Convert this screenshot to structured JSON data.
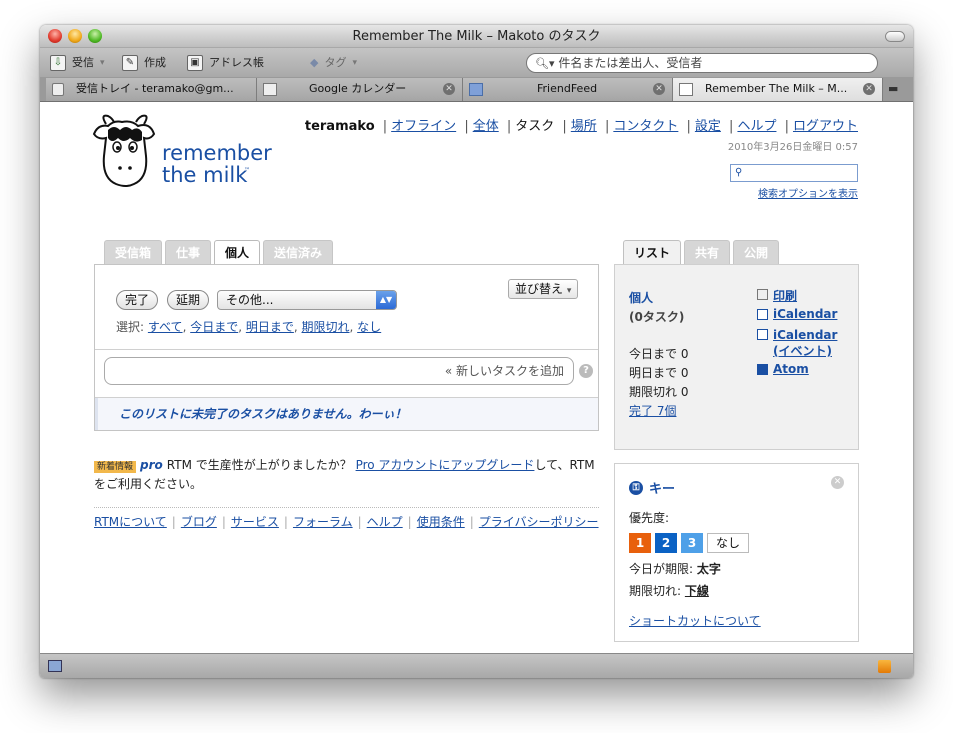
{
  "window": {
    "title": "Remember The Milk – Makoto のタスク"
  },
  "toolbar": {
    "receive_label": "受信",
    "compose_label": "作成",
    "addressbook_label": "アドレス帳",
    "tag_label": "タグ",
    "search_placeholder": "件名または差出人、受信者"
  },
  "tabs": [
    {
      "label": "受信トレイ - teramako@gm..."
    },
    {
      "label": "Google カレンダー"
    },
    {
      "label": "FriendFeed"
    },
    {
      "label": "Remember The Milk – M..."
    }
  ],
  "topnav": {
    "user": "teramako",
    "links": [
      "オフライン",
      "全体",
      "タスク",
      "場所",
      "コンタクト",
      "設定",
      "ヘルプ",
      "ログアウト"
    ],
    "current": "タスク",
    "date": "2010年3月26日金曜日 0:57",
    "search_options": "検索オプションを表示"
  },
  "logo": {
    "line1": "remember",
    "line2": "the milk",
    "tm": "™"
  },
  "main_tabs": [
    "受信箱",
    "仕事",
    "個人",
    "送信済み"
  ],
  "active_main_tab": "個人",
  "actions": {
    "complete": "完了",
    "postpone": "延期",
    "more": "その他...",
    "sort": "並び替え"
  },
  "select_row": {
    "label": "選択:",
    "options": [
      "すべて",
      "今日まで",
      "明日まで",
      "期限切れ",
      "なし"
    ]
  },
  "add_task_placeholder": "« 新しいタスクを追加",
  "empty_message": "このリストに未完了のタスクはありません。わーぃ！",
  "promo": {
    "badge": "新着情報",
    "pro": "pro",
    "text_before": "RTM で生産性が上がりましたか？",
    "link": "Pro アカウントにアップグレード",
    "text_after": "して、RTM をご利用ください。"
  },
  "footer_links": [
    "RTMについて",
    "ブログ",
    "サービス",
    "フォーラム",
    "ヘルプ",
    "使用条件",
    "プライバシーポリシー"
  ],
  "right_tabs": [
    "リスト",
    "共有",
    "公開"
  ],
  "list_info": {
    "name": "個人",
    "count": "(0タスク)",
    "due_today": "今日まで 0",
    "due_tomorrow": "明日まで 0",
    "overdue": "期限切れ 0",
    "completed": "完了 7個",
    "print": "印刷",
    "icalendar": "iCalendar",
    "icalendar_events": "iCalendar (イベント)",
    "atom": "Atom"
  },
  "key_box": {
    "title": "キー",
    "priority_label": "優先度:",
    "priorities": [
      "1",
      "2",
      "3",
      "なし"
    ],
    "due_today_label": "今日が期限:",
    "due_today_value": "太字",
    "overdue_label": "期限切れ:",
    "overdue_value": "下線",
    "shortcuts": "ショートカットについて"
  },
  "colors": {
    "link": "#1a4fa3",
    "priority1": "#e8600c",
    "priority2": "#0b62c4",
    "priority3": "#4ea0e8",
    "rss": "#f29b1b"
  }
}
